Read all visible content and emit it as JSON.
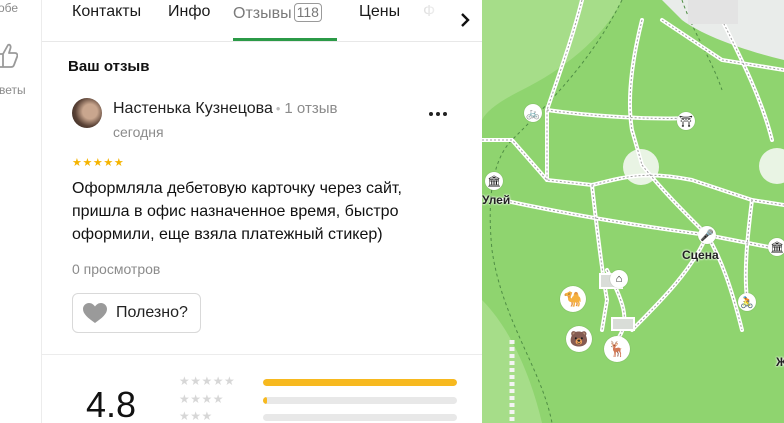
{
  "rail": {
    "top_text": "обе",
    "bottom_text": "веты"
  },
  "tabs": [
    {
      "label": "Контакты"
    },
    {
      "label": "Инфо"
    },
    {
      "label": "Отзывы",
      "count": "118"
    },
    {
      "label": "Цены"
    },
    {
      "label": "Ф"
    }
  ],
  "review_section": {
    "title": "Ваш отзыв"
  },
  "review": {
    "author": "Настенька Кузнецова",
    "author_reviews": "1 отзыв",
    "date": "сегодня",
    "stars": "★★★★★",
    "rating": 5,
    "text": "Оформляла дебетовую карточку через сайт, пришла в офис назначенное время, быстро оформили, еще взяла платежный стикер)",
    "views": "0 просмотров",
    "helpful_label": "Полезно?"
  },
  "summary": {
    "rating": "4.8",
    "distribution": [
      {
        "stars": "★★★★★",
        "fraction": 1.0
      },
      {
        "stars": "★★★★",
        "fraction": 0.02
      },
      {
        "stars": "★★★",
        "fraction": 0.0
      }
    ]
  },
  "map": {
    "labels": {
      "stage": "Сцена",
      "street": "Улей",
      "edge": "Ж"
    },
    "pois": [
      "bicycle-icon",
      "signpost-icon",
      "museum-icon",
      "microphone-icon",
      "camel-icon",
      "bear-icon",
      "deer-icon",
      "bike-rental-icon",
      "monument-icon",
      "building-icon"
    ]
  },
  "colors": {
    "accent_green": "#2b9a47",
    "star_yellow": "#f5b400",
    "bar_yellow": "#f7b91f",
    "park_green": "#8fd46f"
  }
}
